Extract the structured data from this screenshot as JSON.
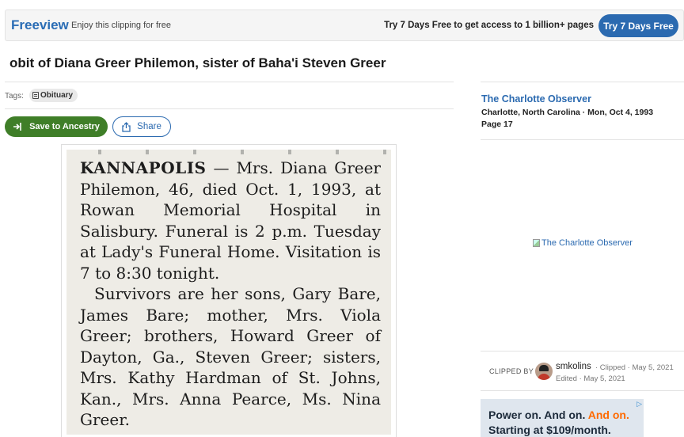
{
  "topbar": {
    "brand": "Freeview",
    "tagline": "Enjoy this clipping for free",
    "promo": "Try 7 Days Free to get access to 1 billion+ pages",
    "cta": "Try 7 Days Free"
  },
  "page": {
    "title": "obit of Diana Greer Philemon, sister of Baha'i Steven Greer"
  },
  "tags": {
    "label": "Tags:",
    "items": [
      "Obituary"
    ]
  },
  "actions": {
    "save": "Save to Ancestry",
    "share": "Share"
  },
  "clipping": {
    "lead": "KANNAPOLIS",
    "body": " — Mrs. Diana Greer Philemon, 46, died Oct. 1, 1993, at Rowan Memorial Hospital in Salisbury. Funeral is 2 p.m. Tuesday at Lady's Funeral Home. Visitation is 7 to 8:30 tonight.",
    "paragraph2": "Survivors are her sons, Gary Bare, James Bare; mother, Mrs. Viola Greer; brothers, Howard Greer of Dayton, Ga., Steven Greer; sisters, Mrs. Kathy Hardman of St. Johns, Kan., Mrs. Anna Pearce, Ms. Nina Greer."
  },
  "newspaper": {
    "name": "The Charlotte Observer",
    "location_date": "Charlotte, North Carolina · Mon, Oct 4, 1993",
    "page": "Page 17",
    "logo_alt": "The Charlotte Observer"
  },
  "clipper": {
    "label": "CLIPPED BY",
    "username": "smkolins",
    "clipped": "· Clipped · May 5, 2021",
    "edited": "Edited · May 5, 2021"
  },
  "ad": {
    "line1_a": "Power on. And on. ",
    "line1_b": "And on.",
    "line2": "Starting at $109/month.",
    "badge": "▷"
  },
  "colors": {
    "brand": "#2a6db5",
    "ancestry_green": "#3f7e28",
    "link_blue": "#2b6ab0"
  }
}
